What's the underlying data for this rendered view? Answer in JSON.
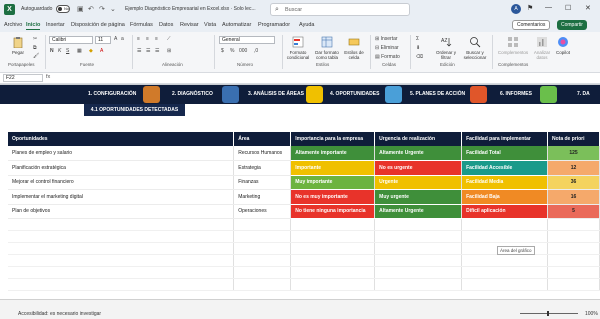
{
  "titlebar": {
    "logo": "X",
    "autosave_label": "Autoguardado",
    "autosave_state": "No",
    "doc_title": "Ejemplo Diagnóstico Empresarial en Excel.xlsx · Solo lec...",
    "search_placeholder": "Buscar",
    "avatar_initial": "A",
    "minimize": "—",
    "maximize": "☐",
    "close": "✕"
  },
  "menu": {
    "tabs": [
      "Archivo",
      "Inicio",
      "Insertar",
      "Disposición de página",
      "Fórmulas",
      "Datos",
      "Revisar",
      "Vista",
      "Automatizar",
      "Programador",
      "Ayuda"
    ],
    "active_index": 1,
    "comments": "Comentarios",
    "share": "Compartir"
  },
  "ribbon": {
    "paste": "Pegar",
    "font_name": "Calibri",
    "font_size": "11",
    "number_format": "General",
    "cond_format": "Formato condicional",
    "as_table": "Dar formato como tabla",
    "cell_styles": "Estilos de celda",
    "insert": "Insertar",
    "delete": "Eliminar",
    "format": "Formato",
    "sort_filter": "Ordenar y filtrar",
    "find_select": "Buscar y seleccionar",
    "addins": "Complementos",
    "analyze": "Analizar datos",
    "copilot": "Copilot",
    "groups": [
      "Portapapeles",
      "Fuente",
      "Alineación",
      "Número",
      "Estilos",
      "Celdas",
      "Edición",
      "Complementos"
    ]
  },
  "formula": {
    "namebox": "F22",
    "fx": "fx"
  },
  "banner": {
    "tabs": [
      "1. CONFIGURACIÓN",
      "2. DIAGNÓSTICO",
      "3. ANÁLISIS DE ÁREAS",
      "4. OPORTUNIDADES",
      "5. PLANES DE ACCIÓN",
      "6. INFORMES",
      "7. DA"
    ],
    "active_index": 3,
    "subtitle": "4.1 OPORTUNIDADES DETECTADAS"
  },
  "table": {
    "headers": [
      "Oportunidades",
      "Área",
      "Importancia para la empresa",
      "Urgencia de realización",
      "Facilidad para implementar",
      "Nota de priori"
    ],
    "rows": [
      {
        "op": "Planes de empleo y salario",
        "area": "Recursos Humanos",
        "imp": "Altamente importante",
        "urg": "Altamente Urgente",
        "fac": "Facilidad Total",
        "nota": "125"
      },
      {
        "op": "Planificación estratégica",
        "area": "Estrategia",
        "imp": "Importante",
        "urg": "No es urgente",
        "fac": "Facilidad Accesible",
        "nota": "12"
      },
      {
        "op": "Mejorar el control financiero",
        "area": "Finanzas",
        "imp": "Muy importante",
        "urg": "Urgente",
        "fac": "Facilidad Media",
        "nota": "36"
      },
      {
        "op": "Implementar el marketing digital",
        "area": "Marketing",
        "imp": "No es muy importante",
        "urg": "Muy urgente",
        "fac": "Facilidad Baja",
        "nota": "16"
      },
      {
        "op": "Plan de objetivos",
        "area": "Operaciones",
        "imp": "No tiene ninguna importancia",
        "urg": "Altamente Urgente",
        "fac": "Difícil aplicación",
        "nota": "5"
      }
    ]
  },
  "colors": {
    "navy": "#0f1d3a",
    "dark_green": "#3f8f3a",
    "green": "#6cb33f",
    "yellow": "#f0c000",
    "orange": "#f08a24",
    "red": "#e8332a",
    "teal": "#1a9a8a",
    "score_green": "#7bbf5a",
    "score_light": "#b6d77f",
    "score_yellow": "#f4d35e",
    "score_orange": "#f5a96b",
    "score_red": "#ea6a5a"
  },
  "chart_tooltip": "Área del gráfico",
  "status": {
    "accessibility": "Accesibilidad: es necesario investigar",
    "zoom": "100%"
  }
}
